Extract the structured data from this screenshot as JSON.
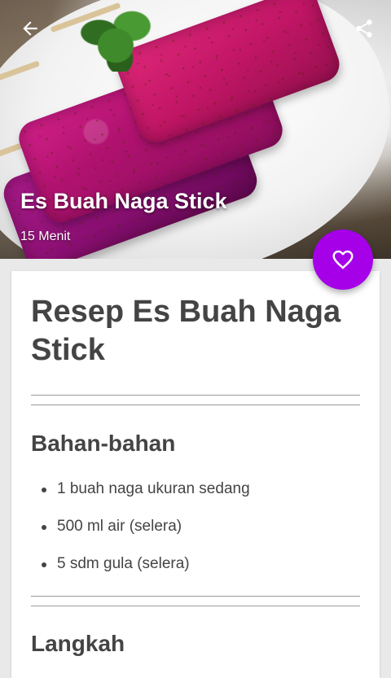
{
  "hero": {
    "title": "Es Buah Naga Stick",
    "duration": "15 Menit"
  },
  "toolbar": {
    "back_icon": "arrow-left-icon",
    "share_icon": "share-icon"
  },
  "fab": {
    "icon": "heart-outline-icon",
    "color": "#a500e8"
  },
  "recipe": {
    "title": "Resep Es Buah Naga Stick",
    "ingredients_heading": "Bahan-bahan",
    "ingredients": [
      "1 buah naga ukuran sedang",
      "500 ml air (selera)",
      "5 sdm gula (selera)"
    ],
    "steps_heading": "Langkah"
  }
}
